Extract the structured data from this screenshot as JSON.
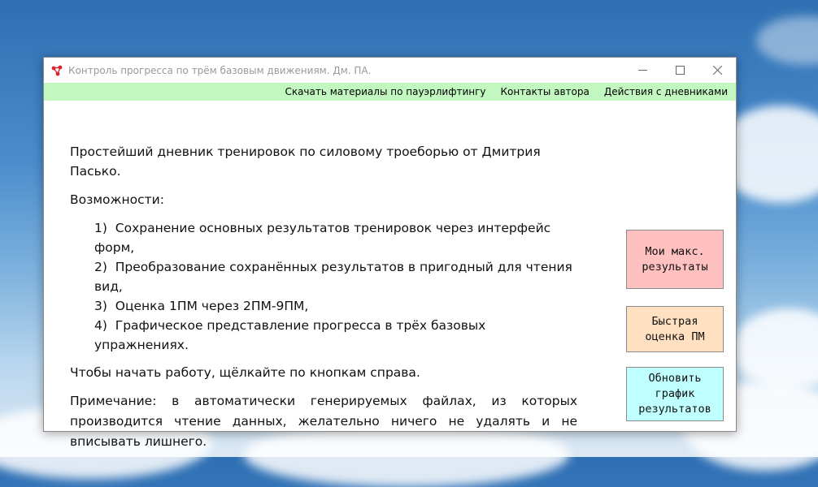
{
  "window": {
    "title": "Контроль прогресса по трём базовым движениям. Дм. ПА.",
    "controls": {
      "minimize": "—",
      "maximize": "☐",
      "close": "✕"
    }
  },
  "menu": {
    "items": [
      {
        "label": "Скачать материалы по пауэрлифтингу"
      },
      {
        "label": "Контакты автора"
      },
      {
        "label": "Действия с дневниками"
      }
    ]
  },
  "content": {
    "intro": "Простейший дневник тренировок по силовому троеборью от Дмитрия Пасько.",
    "features_heading": "Возможности:",
    "features": [
      "Сохранение основных результатов тренировок через интерфейс форм,",
      "Преобразование сохранённых результатов в пригодный для чтения вид,",
      "Оценка 1ПМ через 2ПМ-9ПМ,",
      "Графическое представление прогресса в трёх базовых упражнениях."
    ],
    "start_hint": "Чтобы начать работу, щёлкайте по кнопкам справа.",
    "note": "Примечание: в автоматически генерируемых файлах, из которых производится чтение данных, желательно ничего не удалять и не вписывать лишнего."
  },
  "buttons": {
    "max_results": {
      "label": "Мои макс. результаты",
      "color": "#ffc0c0"
    },
    "quick_estimate": {
      "label": "Быстрая оценка ПМ",
      "color": "#ffe0c0"
    },
    "update_chart": {
      "label": "Обновить график результатов",
      "color": "#c0ffff"
    }
  },
  "colors": {
    "menubar": "#c3f7c0",
    "title_text": "#999999"
  }
}
